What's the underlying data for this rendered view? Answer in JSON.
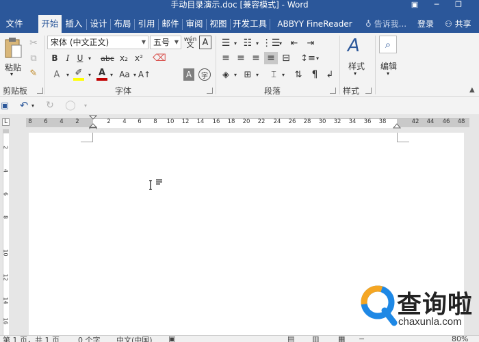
{
  "window": {
    "title": "手动目录演示.doc [兼容模式] - Word"
  },
  "tabs": [
    {
      "label": "文件"
    },
    {
      "label": "开始"
    },
    {
      "label": "插入"
    },
    {
      "label": "设计"
    },
    {
      "label": "布局"
    },
    {
      "label": "引用"
    },
    {
      "label": "邮件"
    },
    {
      "label": "审阅"
    },
    {
      "label": "视图"
    },
    {
      "label": "开发工具"
    },
    {
      "label": "ABBYY FineReader 11"
    }
  ],
  "tell_me": {
    "placeholder": "告诉我..."
  },
  "account": {
    "login_label": "登录",
    "share_label": "共享"
  },
  "ribbon": {
    "clipboard": {
      "paste_label": "粘贴",
      "group_label": "剪贴板"
    },
    "font": {
      "font_name": "宋体 (中文正文)",
      "font_size": "五号",
      "group_label": "字体",
      "bold": "B",
      "italic": "I",
      "underline": "U",
      "strike": "abc",
      "subscript": "x₂",
      "superscript": "x²",
      "case": "Aa",
      "wen": "wén",
      "boxed": "A",
      "shade_a": "A",
      "circled": "字"
    },
    "paragraph": {
      "group_label": "段落"
    },
    "styles": {
      "styles_label": "样式",
      "group_label": "样式"
    },
    "editing": {
      "edit_label": "编辑"
    }
  },
  "ruler": {
    "labels": [
      "8",
      "6",
      "4",
      "2",
      "2",
      "4",
      "6",
      "8",
      "10",
      "12",
      "14",
      "16",
      "18",
      "20",
      "22",
      "24",
      "26",
      "28",
      "30",
      "32",
      "34",
      "36",
      "38",
      "42",
      "44",
      "46",
      "48"
    ]
  },
  "vruler": {
    "labels": [
      "2",
      "4",
      "6",
      "8",
      "10",
      "12",
      "14",
      "16"
    ]
  },
  "status": {
    "page": "第 1 页，共 1 页",
    "words": "0 个字",
    "language": "中文(中国)",
    "zoom": "80%"
  },
  "watermark": {
    "main": "查询啦",
    "sub": "chaxunla.com"
  },
  "colors": {
    "accent": "#2b579a",
    "font_color_bar": "#c00000",
    "highlight_bar": "#ffff00"
  }
}
